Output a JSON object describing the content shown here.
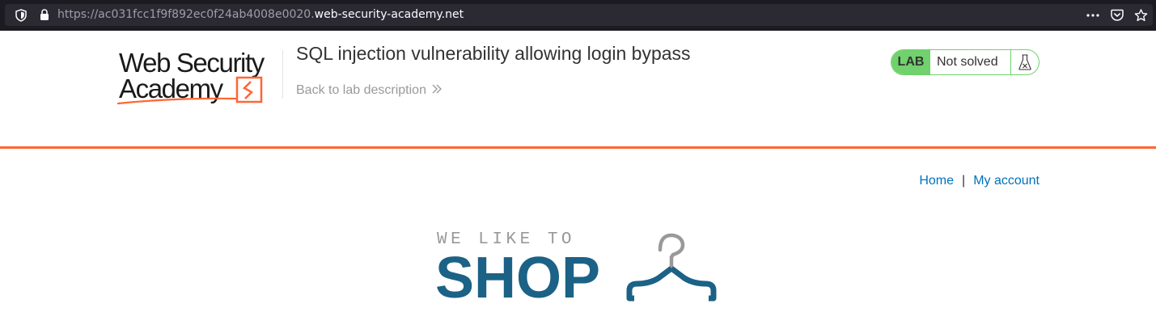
{
  "browser": {
    "url_prefix": "https://ac031fcc1f9f892ec0f24ab4008e0020.",
    "url_domain": "web-security-academy.net",
    "icons": [
      "shield-icon",
      "lock-icon",
      "more-icon",
      "pocket-icon",
      "star-icon"
    ]
  },
  "logo": {
    "line1": "Web Security",
    "line2": "Academy",
    "accent_color": "#ff6633"
  },
  "lab": {
    "title": "SQL injection vulnerability allowing login bypass",
    "back_link": "Back to lab description",
    "badge": "LAB",
    "status": "Not solved",
    "status_color": "#70d16d"
  },
  "nav": {
    "home": "Home",
    "separator": "|",
    "my_account": "My account"
  },
  "shop": {
    "tagline": "WE LIKE TO",
    "word": "SHOP",
    "color": "#1b6286"
  }
}
